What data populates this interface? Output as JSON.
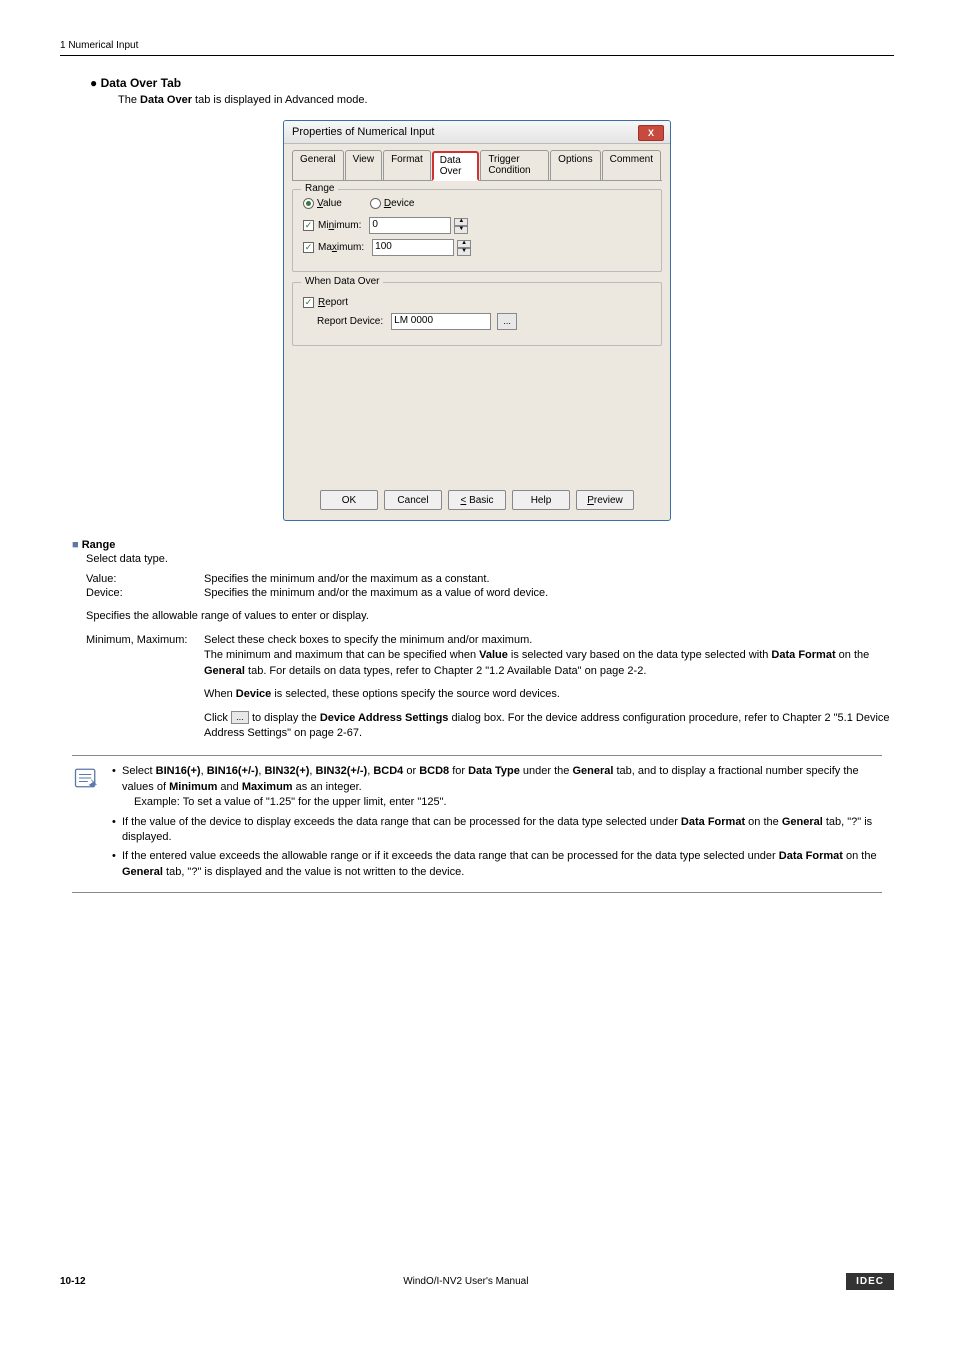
{
  "header": {
    "text": "1 Numerical Input"
  },
  "section": {
    "title": "Data Over Tab",
    "intro_prefix": "The ",
    "intro_bold": "Data Over",
    "intro_suffix": " tab is displayed in Advanced mode."
  },
  "dialog": {
    "title": "Properties of Numerical Input",
    "close_glyph": "X",
    "tabs": [
      "General",
      "View",
      "Format",
      "Data Over",
      "Trigger Condition",
      "Options",
      "Comment"
    ],
    "range": {
      "legend": "Range",
      "radio_value": "Value",
      "radio_device": "Device",
      "min_label": "Minimum:",
      "min_val": "0",
      "max_label": "Maximum:",
      "max_val": "100"
    },
    "wdo": {
      "legend": "When Data Over",
      "report_label": "Report",
      "report_device_label": "Report Device:",
      "report_device_val": "LM 0000",
      "browse": "..."
    },
    "buttons": {
      "ok": "OK",
      "cancel": "Cancel",
      "basic": "< Basic",
      "help": "Help",
      "preview": "Preview"
    }
  },
  "range_section": {
    "heading": "Range",
    "sub": "Select data type.",
    "value_label": "Value:",
    "value_desc": "Specifies the minimum and/or the maximum as a constant.",
    "device_label": "Device:",
    "device_desc": "Specifies the minimum and/or the maximum as a value of word device.",
    "allowable": "Specifies the allowable range of values to enter or display.",
    "mm_label": "Minimum, Maximum:",
    "mm_desc1": "Select these check boxes to specify the minimum and/or maximum.",
    "mm_desc2a": "The minimum and maximum that can be specified when ",
    "mm_desc2b": "Value",
    "mm_desc2c": " is selected vary based on the data type selected with ",
    "mm_desc2d": "Data Format",
    "mm_desc2e": " on the ",
    "mm_desc2f": "General",
    "mm_desc2g": " tab. For details on data types, refer to Chapter 2 \"1.2 Available Data\" on page 2-2.",
    "mm_desc3a": "When ",
    "mm_desc3b": "Device",
    "mm_desc3c": " is selected, these options specify the source word devices.",
    "mm_desc4a": "Click ",
    "mm_desc4b": " to display the ",
    "mm_desc4c": "Device Address Settings",
    "mm_desc4d": " dialog box. For the device address configuration procedure, refer to Chapter 2 \"5.1 Device Address Settings\" on page 2-67.",
    "ellipsis": "..."
  },
  "note": {
    "li1a": "Select ",
    "li1_b1": "BIN16(+)",
    "li1_c1": ", ",
    "li1_b2": "BIN16(+/-)",
    "li1_c2": ", ",
    "li1_b3": "BIN32(+)",
    "li1_c3": ", ",
    "li1_b4": "BIN32(+/-)",
    "li1_c4": ", ",
    "li1_b5": "BCD4",
    "li1_c5": " or ",
    "li1_b6": "BCD8",
    "li1_c6": " for ",
    "li1_b7": "Data Type",
    "li1_c7": " under the ",
    "li1_b8": "General",
    "li1_c8": " tab, and to display a fractional number specify the values of ",
    "li1_b9": "Minimum",
    "li1_c9": " and ",
    "li1_b10": "Maximum",
    "li1_c10": " as an integer.",
    "li1_ex": "Example: To set a value of \"1.25\" for the upper limit, enter \"125\".",
    "li2a": "If the value of the device to display exceeds the data range that can be processed for the data type selected under ",
    "li2b": "Data Format",
    "li2c": " on the ",
    "li2d": "General",
    "li2e": " tab, \"?\" is displayed.",
    "li3a": "If the entered value exceeds the allowable range or if it exceeds the data range that can be processed for the data type selected under ",
    "li3b": "Data Format",
    "li3c": " on the ",
    "li3d": "General",
    "li3e": " tab, \"?\" is displayed and the value is not written to the device."
  },
  "footer": {
    "page": "10-12",
    "manual": "WindO/I-NV2 User's Manual",
    "brand": "IDEC"
  }
}
